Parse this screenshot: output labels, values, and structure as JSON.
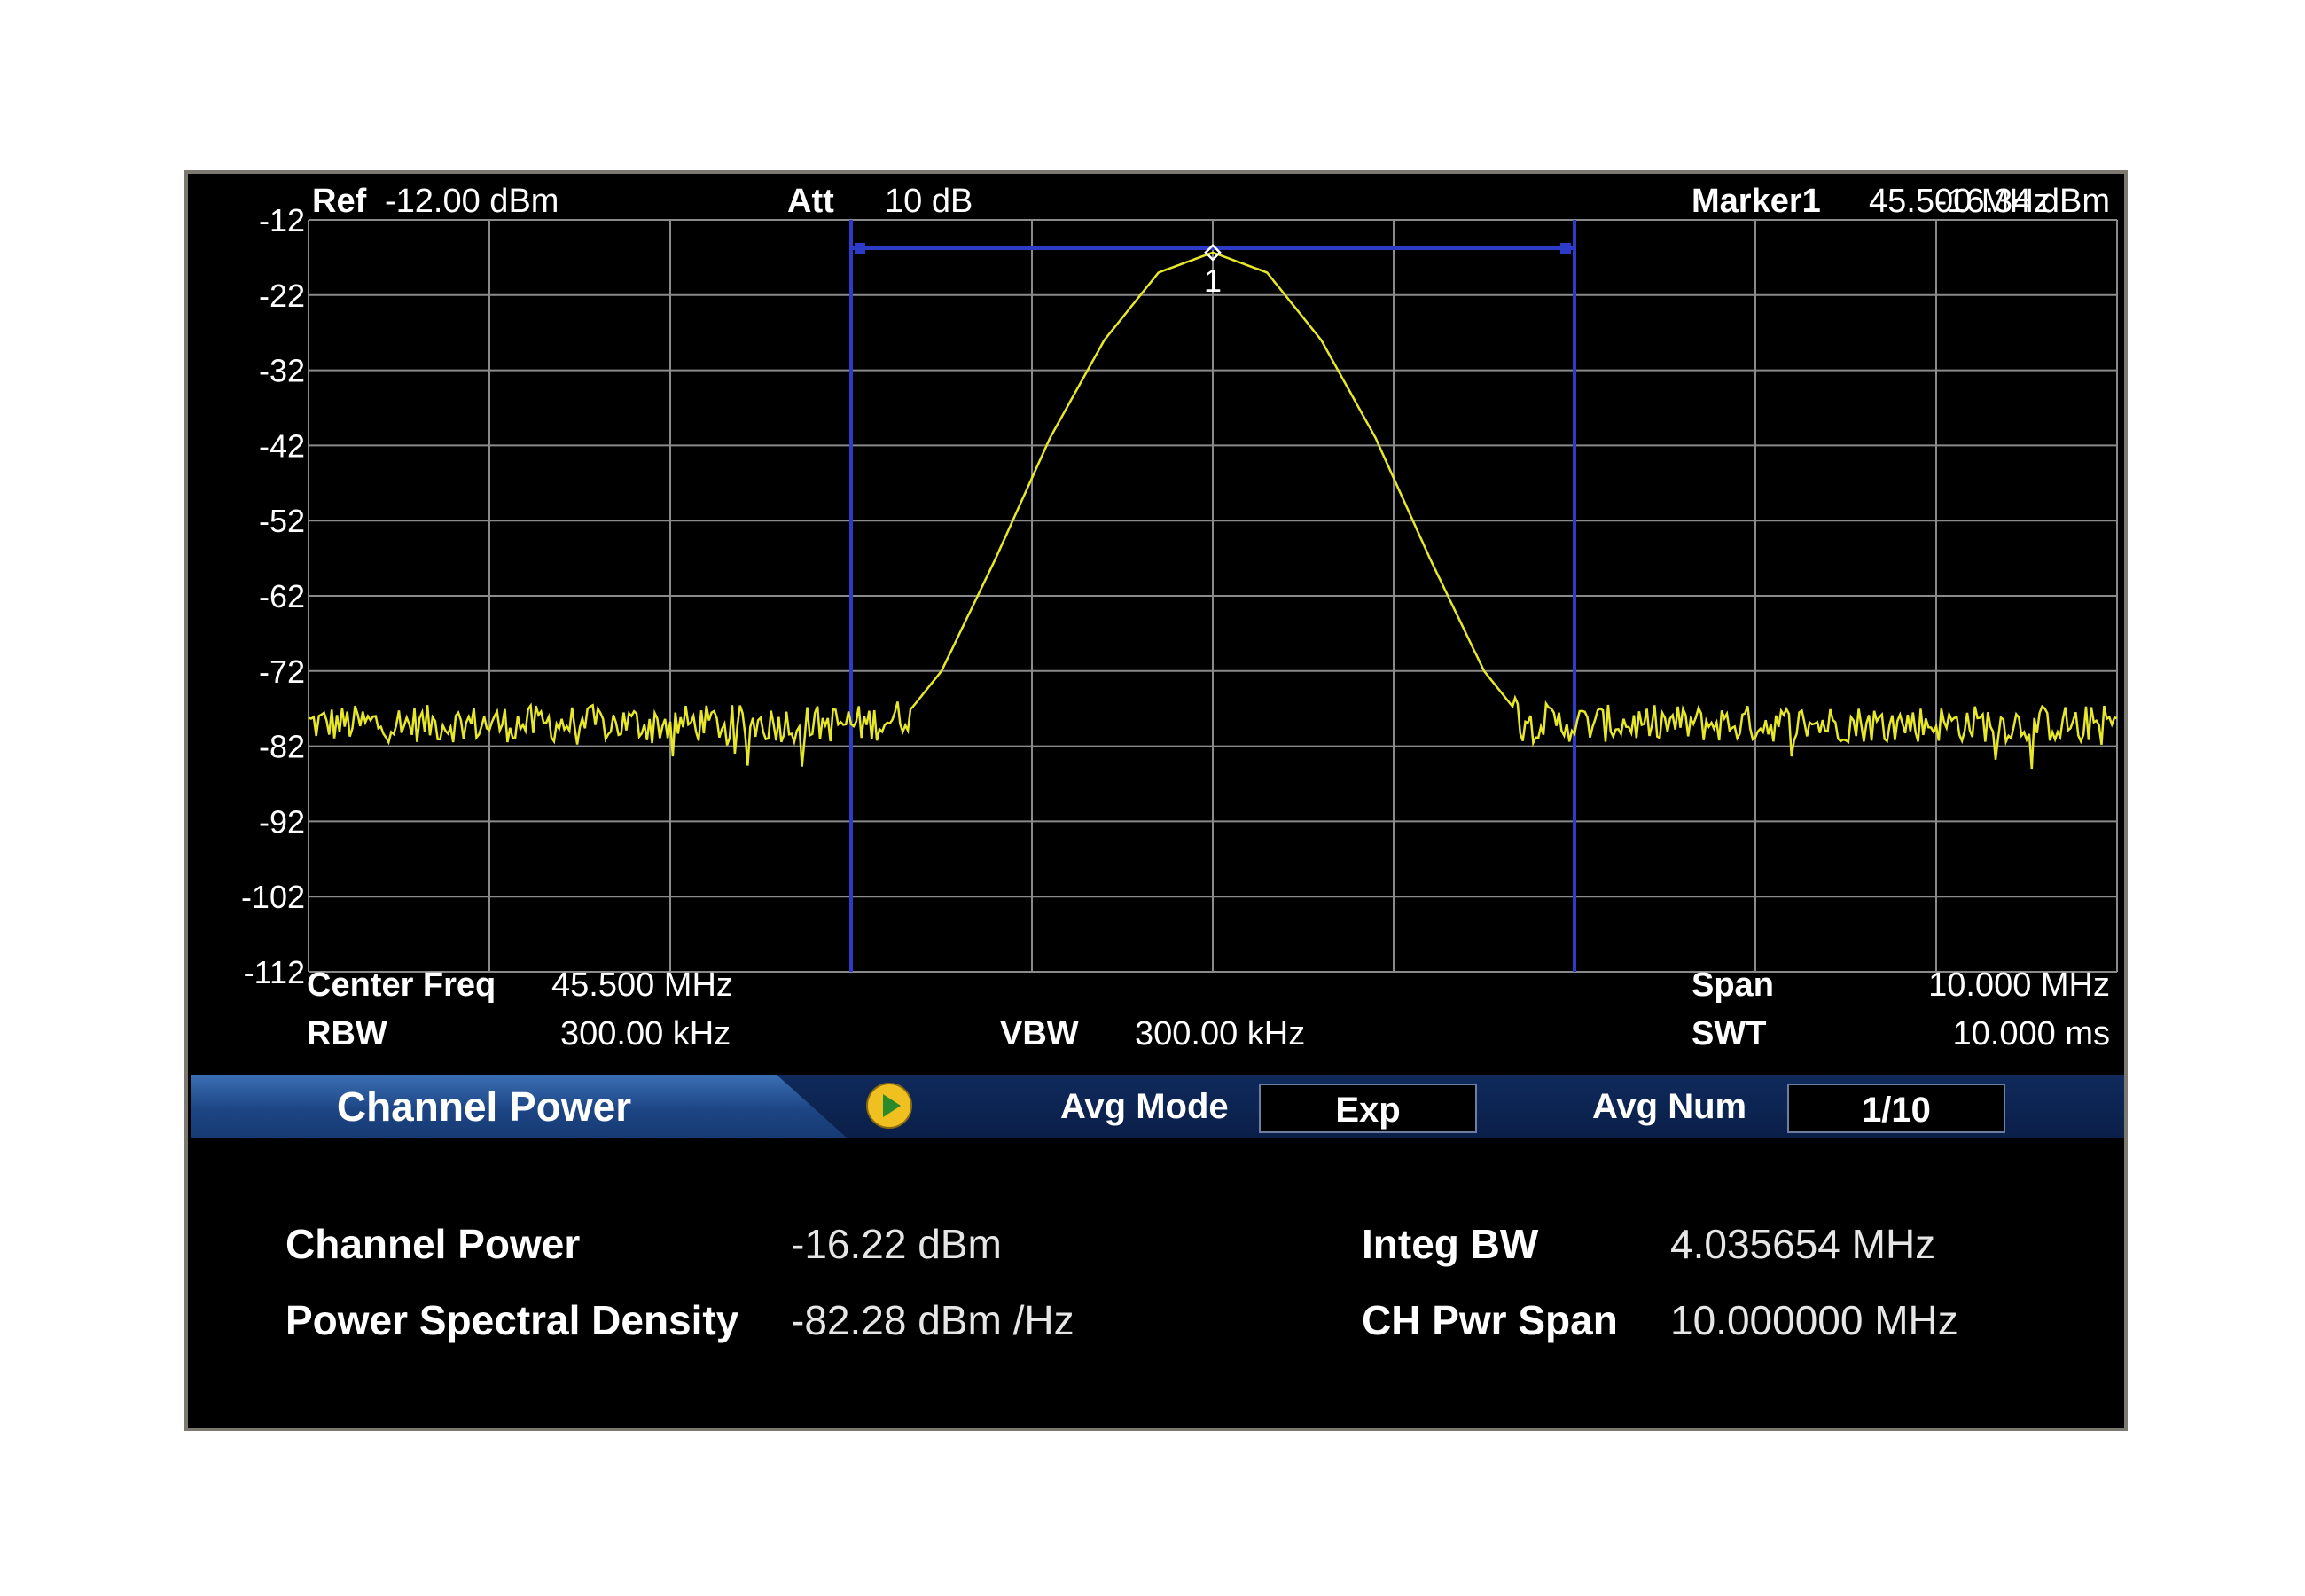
{
  "header": {
    "ref_label": "Ref",
    "ref_value": "-12.00 dBm",
    "att_label": "Att",
    "att_value": "10 dB",
    "marker_label": "Marker1",
    "marker_freq": "45.500 MHz",
    "marker_level": "-16.34 dBm",
    "marker_id": "1"
  },
  "footer": {
    "center_freq_label": "Center Freq",
    "center_freq_value": "45.500 MHz",
    "rbw_label": "RBW",
    "rbw_value": "300.00 kHz",
    "vbw_label": "VBW",
    "vbw_value": "300.00 kHz",
    "span_label": "Span",
    "span_value": "10.000 MHz",
    "swt_label": "SWT",
    "swt_value": "10.000 ms"
  },
  "colors": {
    "trace": "#e8e82a",
    "channel_lines": "#2c3cc8",
    "grid": "#8a8a8a",
    "background": "#000000",
    "play_icon": "#f0c020"
  },
  "chart_data": {
    "type": "line",
    "ylim": [
      -112,
      -12
    ],
    "y_ticks": [
      "-12",
      "-22",
      "-32",
      "-42",
      "-52",
      "-62",
      "-72",
      "-82",
      "-92",
      "-102",
      "-112"
    ],
    "x_range_mhz": [
      40.5,
      50.5
    ],
    "grid": true,
    "noise_floor_dbm": -79,
    "peak": {
      "freq_mhz": 45.5,
      "level_dbm": -16.34
    },
    "channel_edges_mhz": [
      43.5,
      47.5
    ],
    "series": [
      {
        "x": [
          40.5,
          43.0,
          43.6,
          43.8,
          44.0,
          44.3,
          44.6,
          44.9,
          45.2,
          45.5,
          45.8,
          46.1,
          46.4,
          46.7,
          47.0,
          47.2,
          47.4,
          47.6,
          48.0,
          50.5
        ],
        "values": [
          -79,
          -79,
          -79,
          -78,
          -72,
          -57,
          -41,
          -28,
          -19,
          -16.34,
          -19,
          -28,
          -41,
          -57,
          -72,
          -78,
          -79,
          -79,
          -79,
          -79
        ]
      }
    ]
  },
  "controls": {
    "mode_title": "Channel Power",
    "play_icon": "play-icon",
    "avg_mode_label": "Avg Mode",
    "avg_mode_value": "Exp",
    "avg_num_label": "Avg Num",
    "avg_num_value": "1/10"
  },
  "results": {
    "channel_power_label": "Channel Power",
    "channel_power_value": "-16.22 dBm",
    "psd_label": "Power Spectral Density",
    "psd_value": "-82.28 dBm /Hz",
    "integ_bw_label": "Integ BW",
    "integ_bw_value": "4.035654 MHz",
    "ch_pwr_span_label": "CH Pwr Span",
    "ch_pwr_span_value": "10.000000 MHz"
  }
}
